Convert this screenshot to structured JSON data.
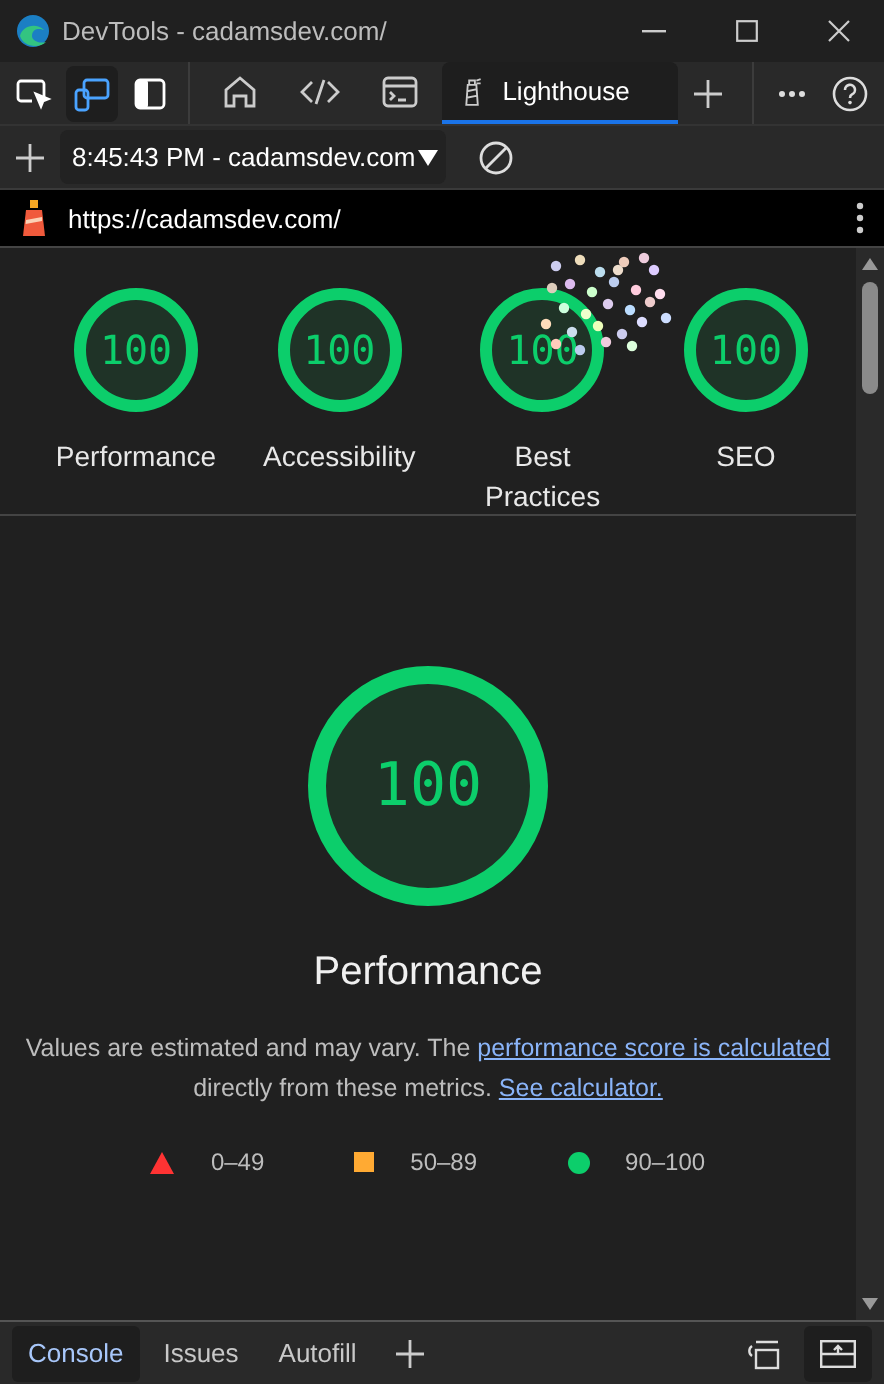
{
  "window": {
    "title": "DevTools - cadamsdev.com/"
  },
  "toolbar_buttons": [
    {
      "kind": "inspect",
      "on": false
    },
    {
      "kind": "device",
      "on": true
    },
    {
      "kind": "dock",
      "on": false
    }
  ],
  "tabs": [
    {
      "kind": "welcome",
      "selected": false
    },
    {
      "kind": "elements",
      "selected": false
    },
    {
      "kind": "console",
      "selected": false
    },
    {
      "kind": "lighthouse",
      "label": "Lighthouse",
      "selected": true
    }
  ],
  "report_selector": {
    "value": "8:45:43 PM - cadamsdev.com"
  },
  "url_bar": {
    "url": "https://cadamsdev.com/"
  },
  "scores": [
    {
      "score": "100",
      "label": "Performance"
    },
    {
      "score": "100",
      "label": "Accessibility"
    },
    {
      "score": "100",
      "label": "Best Practices"
    },
    {
      "score": "100",
      "label": "SEO"
    }
  ],
  "performance": {
    "score": "100",
    "title": "Performance",
    "text_before": "Values are estimated and may vary. The ",
    "link_1": "performance score is calculated",
    "text_middle": " directly from these metrics. ",
    "link_2": "See calculator."
  },
  "legend": [
    {
      "kind": "fail",
      "range": "0–49"
    },
    {
      "kind": "average",
      "range": "50–89"
    },
    {
      "kind": "pass",
      "range": "90–100"
    }
  ],
  "drawer_tabs": [
    {
      "label": "Console",
      "selected": true
    },
    {
      "label": "Issues",
      "selected": false
    },
    {
      "label": "Autofill",
      "selected": false
    }
  ]
}
